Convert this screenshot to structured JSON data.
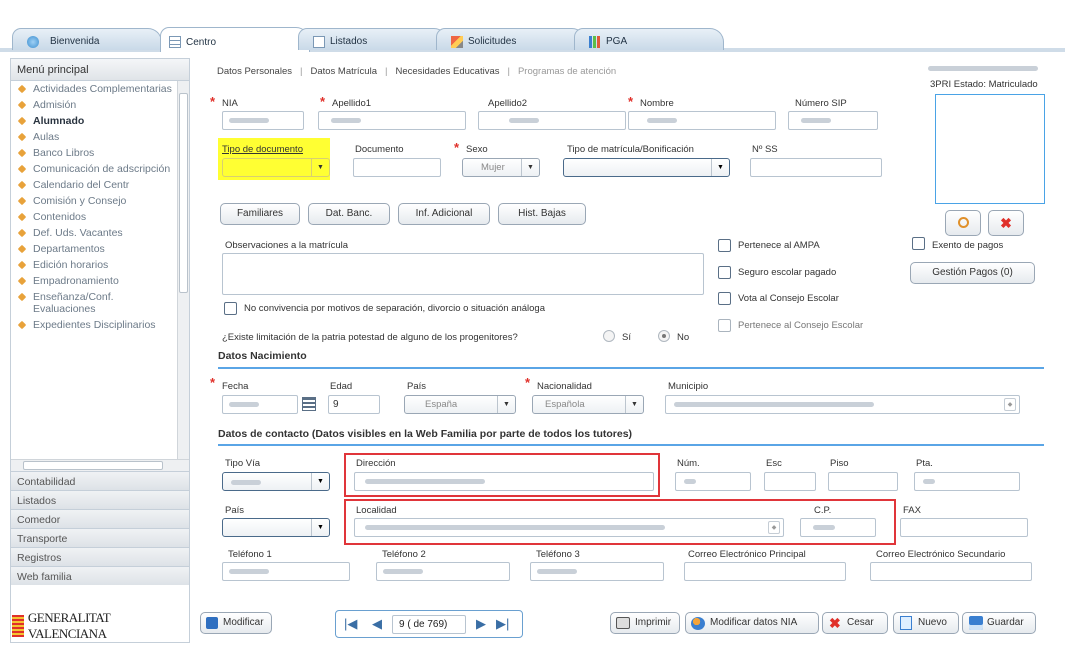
{
  "tabs": [
    {
      "label": "Bienvenida",
      "icon": "globe-icon"
    },
    {
      "label": "Centro",
      "icon": "table-icon",
      "active": true
    },
    {
      "label": "Listados",
      "icon": "list-icon"
    },
    {
      "label": "Solicitudes",
      "icon": "pencil-icon"
    },
    {
      "label": "PGA",
      "icon": "bar-chart-icon"
    }
  ],
  "sidebar": {
    "title": "Menú principal",
    "items": [
      {
        "label": "Actividades Complementarias"
      },
      {
        "label": "Admisión"
      },
      {
        "label": "Alumnado",
        "active": true
      },
      {
        "label": "Aulas"
      },
      {
        "label": "Banco Libros"
      },
      {
        "label": "Comunicación de adscripción"
      },
      {
        "label": "Calendario del Centr"
      },
      {
        "label": "Comisión y Consejo"
      },
      {
        "label": "Contenidos"
      },
      {
        "label": "Def. Uds. Vacantes"
      },
      {
        "label": "Departamentos"
      },
      {
        "label": "Edición horarios"
      },
      {
        "label": "Empadronamiento"
      },
      {
        "label": "Enseñanza/Conf. Evaluaciones"
      },
      {
        "label": "Expedientes Disciplinarios"
      }
    ],
    "sections": [
      "Contabilidad",
      "Listados",
      "Comedor",
      "Transporte",
      "Registros",
      "Web familia"
    ],
    "logo_text": "GENERALITAT VALENCIANA"
  },
  "subnav": {
    "items": [
      "Datos Personales",
      "Datos Matrícula",
      "Necesidades Educativas",
      "Programas de atención"
    ],
    "sep": "|"
  },
  "status": {
    "text": "3PRI Estado: Matriculado"
  },
  "form": {
    "nia_label": "NIA",
    "apellido1_label": "Apellido1",
    "apellido2_label": "Apellido2",
    "nombre_label": "Nombre",
    "sip_label": "Número SIP",
    "tipo_doc_label": "Tipo de documento",
    "documento_label": "Documento",
    "sexo_label": "Sexo",
    "sexo_value": "Mujer",
    "tipo_matricula_label": "Tipo de matrícula/Bonificación",
    "nss_label": "Nº SS",
    "obs_label": "Observaciones a la matrícula",
    "no_convivencia_label": "No convivencia por motivos de separación, divorcio o situación análoga",
    "limitacion_label": "¿Existe limitación de la patria potestad de alguno de los progenitores?",
    "si_label": "Sí",
    "no_label": "No",
    "ampa_label": "Pertenece al AMPA",
    "seguro_label": "Seguro escolar pagado",
    "vota_label": "Vota al Consejo Escolar",
    "pertenece_consejo_label": "Pertenece al Consejo Escolar",
    "exento_label": "Exento de pagos"
  },
  "buttons": {
    "familiares": "Familiares",
    "banc": "Dat. Banc.",
    "inf": "Inf. Adicional",
    "bajas": "Hist. Bajas",
    "gestion_pagos": "Gestión Pagos (0)",
    "modificar": "Modificar",
    "imprimir": "Imprimir",
    "modificar_nia": "Modificar datos NIA",
    "cesar": "Cesar",
    "nuevo": "Nuevo",
    "guardar": "Guardar"
  },
  "nacimiento": {
    "title": "Datos Nacimiento",
    "fecha_label": "Fecha",
    "edad_label": "Edad",
    "edad_value": "9",
    "pais_label": "País",
    "pais_value": "España",
    "nacionalidad_label": "Nacionalidad",
    "nacionalidad_value": "Española",
    "municipio_label": "Municipio"
  },
  "contacto": {
    "title": "Datos de contacto (Datos visibles en la Web Familia por parte de todos los tutores)",
    "tipo_via_label": "Tipo Vía",
    "direccion_label": "Dirección",
    "num_label": "Núm.",
    "esc_label": "Esc",
    "piso_label": "Piso",
    "pta_label": "Pta.",
    "pais_label": "País",
    "localidad_label": "Localidad",
    "cp_label": "C.P.",
    "fax_label": "FAX",
    "tel1_label": "Teléfono 1",
    "tel2_label": "Teléfono 2",
    "tel3_label": "Teléfono 3",
    "correo1_label": "Correo Electrónico Principal",
    "correo2_label": "Correo Electrónico Secundario"
  },
  "pager": {
    "text": "9 ( de 769)"
  },
  "colors": {
    "accent_line": "#5aa5e6",
    "highlight": "#ffff33",
    "red_box": "#e0353a",
    "required": "#e0302a"
  }
}
